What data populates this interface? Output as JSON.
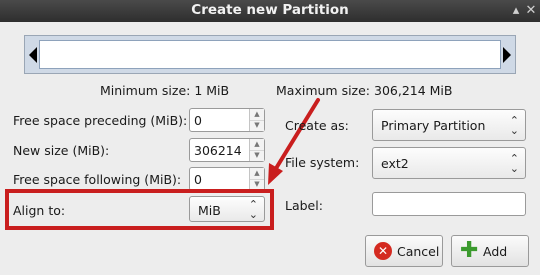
{
  "window": {
    "title": "Create new Partition",
    "buttons": [
      "▴",
      "✕"
    ]
  },
  "sizes": {
    "min_label": "Minimum size: 1 MiB",
    "max_label": "Maximum size: 306,214 MiB"
  },
  "fields": {
    "preceding": {
      "label": "Free space preceding (MiB):",
      "value": "0"
    },
    "new_size": {
      "label": "New size (MiB):",
      "value": "306214"
    },
    "following": {
      "label": "Free space following (MiB):",
      "value": "0"
    },
    "align": {
      "label": "Align to:",
      "value": "MiB"
    },
    "create_as": {
      "label": "Create as:",
      "value": "Primary Partition"
    },
    "file_system": {
      "label": "File system:",
      "value": "ext2"
    },
    "label_field": {
      "label": "Label:",
      "value": ""
    }
  },
  "buttons": {
    "cancel": "Cancel",
    "add": "Add"
  },
  "icons": {
    "spin_up": "▲",
    "spin_down": "▼",
    "combo_arrows": "⌃⌄",
    "cancel_glyph": "✕",
    "add_glyph": "✚"
  },
  "colors": {
    "highlight": "#c91e1e",
    "arrow": "#c91e1e"
  }
}
